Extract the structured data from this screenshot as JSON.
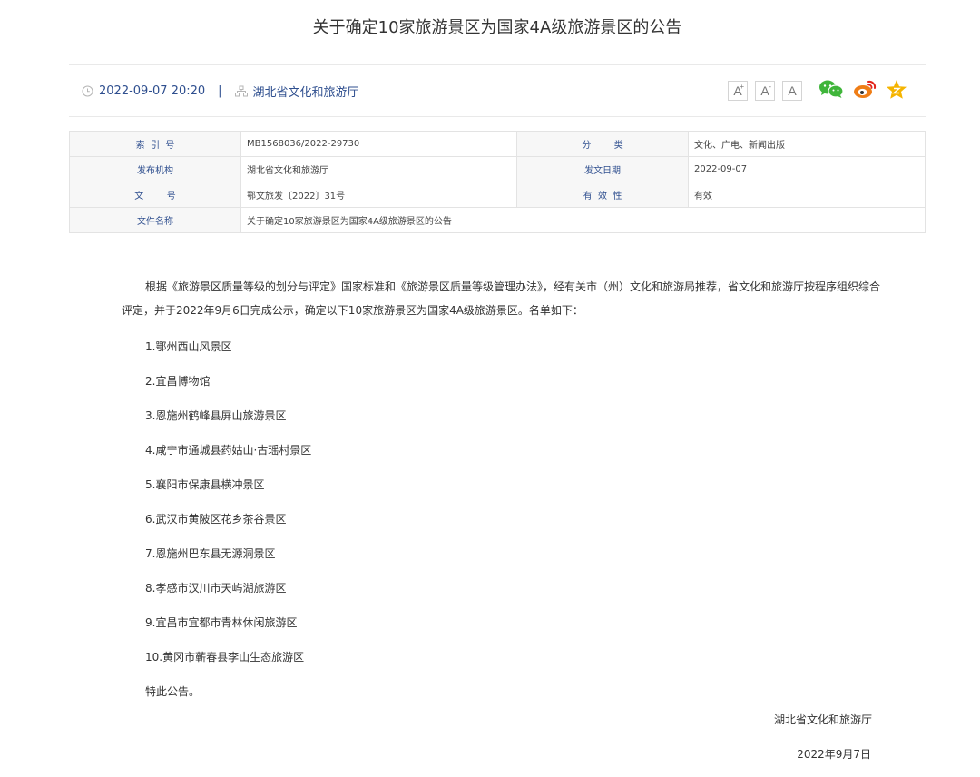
{
  "header": {
    "title": "关于确定10家旅游景区为国家4A级旅游景区的公告"
  },
  "meta": {
    "date": "2022-09-07 20:20",
    "separator": "|",
    "org": "湖北省文化和旅游厅"
  },
  "font_controls": {
    "increase": "A",
    "increase_sup": "+",
    "decrease": "A",
    "decrease_sup": "-",
    "reset": "A"
  },
  "share_icons": [
    "wechat-icon",
    "weibo-icon",
    "favorite-icon"
  ],
  "info": {
    "index_label": "索  引  号",
    "index_value": "MB1568036/2022-29730",
    "category_label": "分        类",
    "category_value": "文化、广电、新闻出版",
    "issuer_label": "发布机构",
    "issuer_value": "湖北省文化和旅游厅",
    "date_label": "发文日期",
    "date_value": "2022-09-07",
    "docno_label": "文        号",
    "docno_value": "鄂文旅发〔2022〕31号",
    "validity_label": "有  效  性",
    "validity_value": "有效",
    "filename_label": "文件名称",
    "filename_value": "关于确定10家旅游景区为国家4A级旅游景区的公告"
  },
  "content": {
    "intro": "根据《旅游景区质量等级的划分与评定》国家标准和《旅游景区质量等级管理办法》，经有关市（州）文化和旅游局推荐，省文化和旅游厅按程序组织综合评定，并于2022年9月6日完成公示，确定以下10家旅游景区为国家4A级旅游景区。名单如下：",
    "items": [
      "1.鄂州西山风景区",
      "2.宜昌博物馆",
      "3.恩施州鹤峰县屏山旅游景区",
      "4.咸宁市通城县药姑山·古瑶村景区",
      "5.襄阳市保康县横冲景区",
      "6.武汉市黄陂区花乡茶谷景区",
      "7.恩施州巴东县无源洞景区",
      "8.孝感市汉川市天屿湖旅游区",
      "9.宜昌市宜都市青林休闲旅游区",
      "10.黄冈市蕲春县李山生态旅游区"
    ],
    "closing": "特此公告。",
    "signature_org": "湖北省文化和旅游厅",
    "signature_date": "2022年9月7日"
  },
  "colors": {
    "link_blue": "#2f4f8f",
    "wechat_green": "#3fb53a",
    "weibo_orange": "#ef7d16",
    "star_yellow": "#f5b400"
  }
}
